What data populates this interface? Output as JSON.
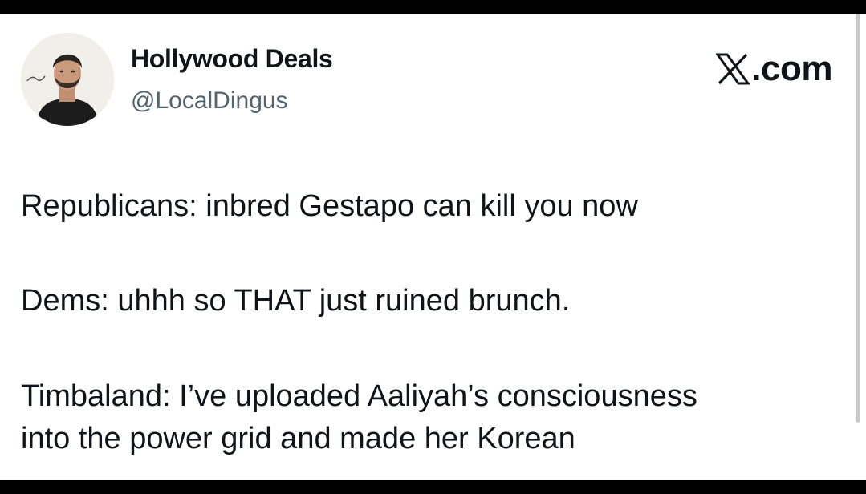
{
  "post": {
    "author": {
      "display_name": "Hollywood Deals",
      "handle": "@LocalDingus",
      "avatar_icon": "profile-photo"
    },
    "brand": {
      "label": ".com",
      "icon": "x-logo-icon"
    },
    "lines": [
      "Republicans: inbred Gestapo can kill you now",
      "Dems: uhhh so THAT just ruined brunch.",
      "Timbaland: I’ve uploaded Aaliyah’s consciousness",
      "into the power grid and made her Korean"
    ]
  },
  "colors": {
    "background": "#ffffff",
    "frame": "#000000",
    "text_primary": "#0f1419",
    "text_secondary": "#536471"
  }
}
